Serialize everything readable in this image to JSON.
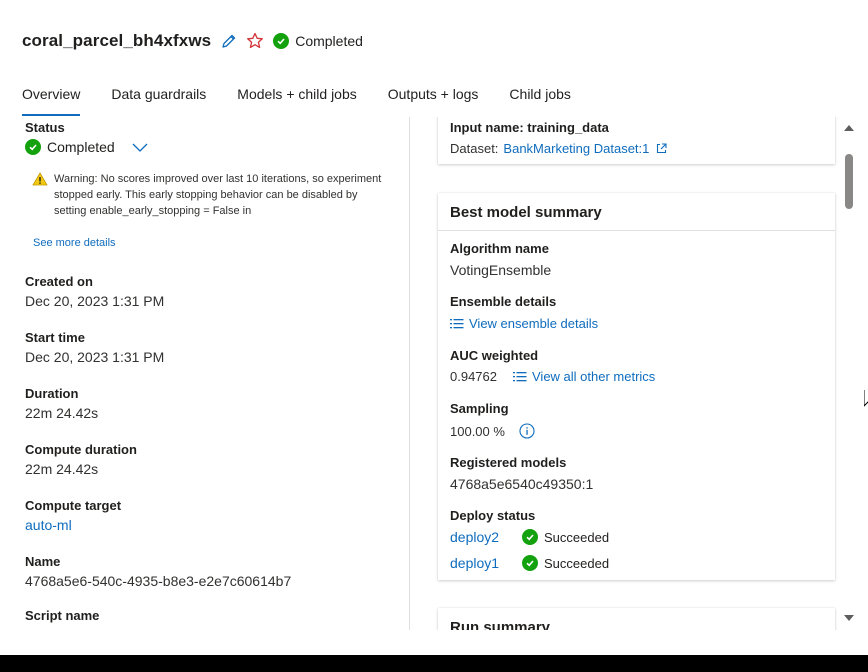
{
  "header": {
    "job_title": "coral_parcel_bh4xfxws",
    "status": "Completed"
  },
  "tabs": [
    {
      "label": "Overview",
      "active": true
    },
    {
      "label": "Data guardrails",
      "active": false
    },
    {
      "label": "Models + child jobs",
      "active": false
    },
    {
      "label": "Outputs + logs",
      "active": false
    },
    {
      "label": "Child jobs",
      "active": false
    }
  ],
  "properties": {
    "status_label": "Status",
    "status_value": "Completed",
    "warning_text": "Warning: No scores improved over last 10 iterations, so experiment stopped early. This early stopping behavior can be disabled by setting enable_early_stopping = False in",
    "see_more": "See more details",
    "created_on_label": "Created on",
    "created_on_value": "Dec 20, 2023 1:31 PM",
    "start_time_label": "Start time",
    "start_time_value": "Dec 20, 2023 1:31 PM",
    "duration_label": "Duration",
    "duration_value": "22m 24.42s",
    "compute_duration_label": "Compute duration",
    "compute_duration_value": "22m 24.42s",
    "compute_target_label": "Compute target",
    "compute_target_value": "auto-ml",
    "name_label": "Name",
    "name_value": "4768a5e6-540c-4935-b8e3-e2e7c60614b7",
    "script_name_label": "Script name"
  },
  "input_card": {
    "input_name": "Input name: training_data",
    "dataset_label": "Dataset:",
    "dataset_link": "BankMarketing Dataset:1"
  },
  "best_model": {
    "header": "Best model summary",
    "algorithm_label": "Algorithm name",
    "algorithm_value": "VotingEnsemble",
    "ensemble_label": "Ensemble details",
    "ensemble_link": "View ensemble details",
    "auc_label": "AUC weighted",
    "auc_value": "0.94762",
    "metrics_link": "View all other metrics",
    "sampling_label": "Sampling",
    "sampling_value": "100.00 %",
    "registered_label": "Registered models",
    "registered_value": "4768a5e6540c49350:1",
    "deploy_label": "Deploy status",
    "deployments": [
      {
        "name": "deploy2",
        "status": "Succeeded"
      },
      {
        "name": "deploy1",
        "status": "Succeeded"
      }
    ]
  },
  "run_summary": {
    "header": "Run summary"
  },
  "colors": {
    "accent": "#0f6cbd",
    "success": "#13a10e",
    "warning": "#f2c811",
    "favorite": "#d13438"
  }
}
